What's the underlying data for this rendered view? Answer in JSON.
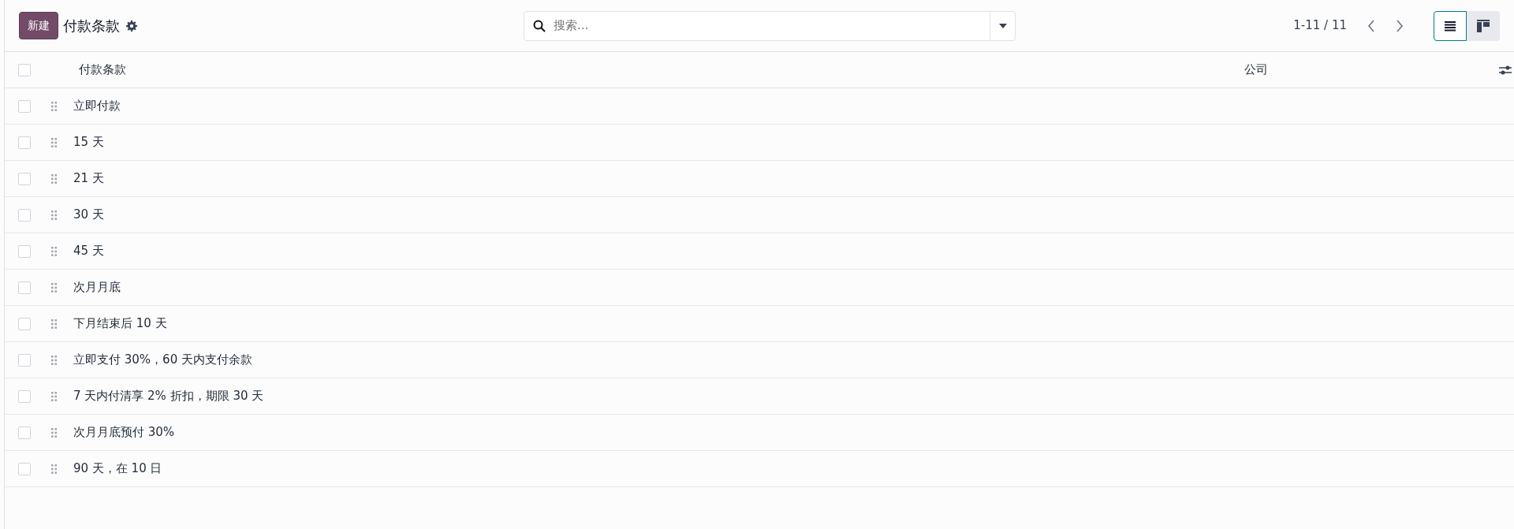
{
  "control_panel": {
    "new_button": "新建",
    "title": "付款条款",
    "search": {
      "placeholder": "搜索..."
    },
    "pager": "1-11 / 11",
    "views": [
      {
        "kind": "list",
        "selected": true
      },
      {
        "kind": "kanban",
        "selected": false
      }
    ]
  },
  "table": {
    "select_all": {
      "checked": false
    },
    "columns": [
      "付款条款",
      "公司"
    ],
    "rows": [
      {
        "name": "立即付款",
        "checked": false
      },
      {
        "name": "15 天",
        "checked": false
      },
      {
        "name": "21 天",
        "checked": false
      },
      {
        "name": "30 天",
        "checked": false
      },
      {
        "name": "45 天",
        "checked": false
      },
      {
        "name": "次月月底",
        "checked": false
      },
      {
        "name": "下月结束后 10 天",
        "checked": false
      },
      {
        "name": "立即支付 30%，60 天内支付余款",
        "checked": false
      },
      {
        "name": "7 天内付清享 2% 折扣，期限 30 天",
        "checked": false
      },
      {
        "name": "次月月底预付 30%",
        "checked": false
      },
      {
        "name": "90 天，在 10 日",
        "checked": false
      }
    ]
  }
}
